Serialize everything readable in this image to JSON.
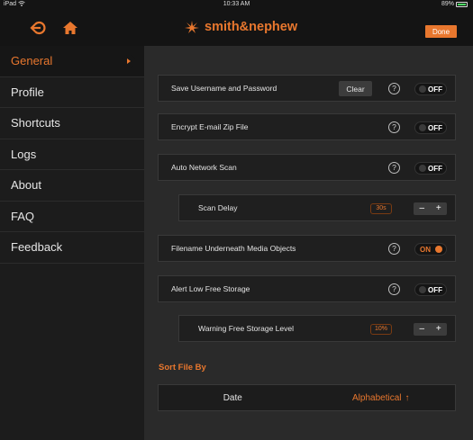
{
  "status_bar": {
    "carrier": "iPad",
    "time": "10:33 AM",
    "battery": "89%",
    "battery_level": 0.89
  },
  "header": {
    "brand_name": "smith&nephew",
    "done_label": "Done",
    "back_icon": "back-icon",
    "home_icon": "home-icon"
  },
  "sidebar": {
    "items": [
      {
        "label": "General",
        "active": true
      },
      {
        "label": "Profile"
      },
      {
        "label": "Shortcuts"
      },
      {
        "label": "Logs"
      },
      {
        "label": "About"
      },
      {
        "label": "FAQ"
      },
      {
        "label": "Feedback"
      }
    ]
  },
  "settings": {
    "save_credentials": {
      "label": "Save Username and Password",
      "clear_label": "Clear",
      "toggle": "OFF"
    },
    "encrypt_zip": {
      "label": "Encrypt E-mail Zip File",
      "toggle": "OFF"
    },
    "auto_scan": {
      "label": "Auto Network Scan",
      "toggle": "OFF"
    },
    "scan_delay": {
      "label": "Scan Delay",
      "value": "30s",
      "minus": "–",
      "plus": "+"
    },
    "filename_underneath": {
      "label": "Filename Underneath Media Objects",
      "toggle": "ON"
    },
    "alert_low_storage": {
      "label": "Alert Low Free Storage",
      "toggle": "OFF"
    },
    "warning_level": {
      "label": "Warning Free Storage Level",
      "value": "10%",
      "minus": "–",
      "plus": "+"
    },
    "help_symbol": "?"
  },
  "sort": {
    "title": "Sort File By",
    "options": [
      "Date",
      "Alphabetical"
    ],
    "selected": "Alphabetical",
    "arrow": "↑"
  },
  "colors": {
    "accent": "#e8772e",
    "background": "#2a2a2a",
    "sidebar": "#1c1c1c",
    "bar": "#141414"
  }
}
